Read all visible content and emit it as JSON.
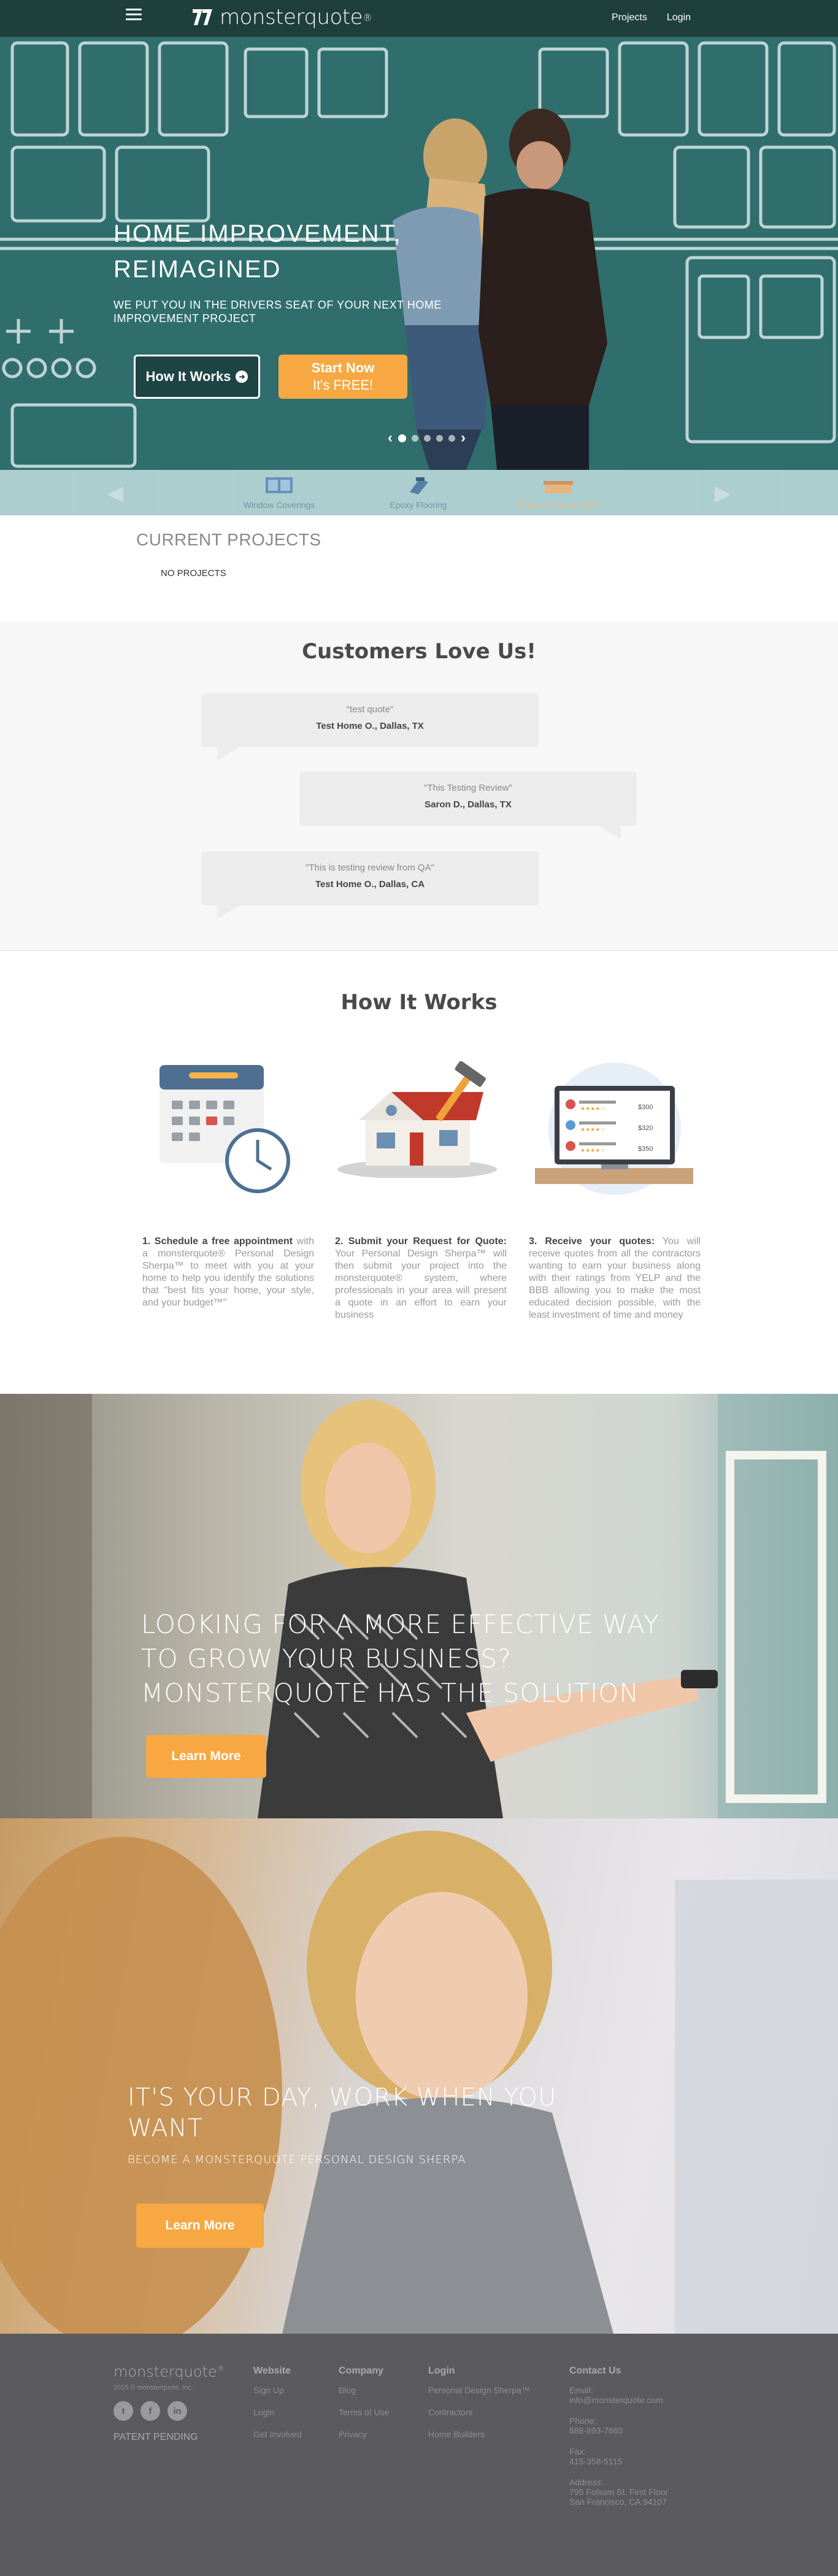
{
  "nav": {
    "brand": "monsterquote",
    "brand_reg": "®",
    "links": [
      "Projects",
      "Login"
    ]
  },
  "hero": {
    "title": "HOME IMPROVEMENT, REIMAGINED",
    "subtitle": "WE PUT YOU IN THE DRIVERS SEAT OF YOUR NEXT HOME IMPROVEMENT PROJECT",
    "how_button": "How It Works",
    "start_line1": "Start Now",
    "start_line2": "It's FREE!",
    "slides": 5,
    "active_slide": 1
  },
  "categories": [
    "Window Coverings",
    "Epoxy Flooring",
    "Granite Counter Tops"
  ],
  "current_projects": {
    "title": "CURRENT PROJECTS",
    "empty": "NO PROJECTS"
  },
  "reviews": {
    "title": "Customers Love Us!",
    "items": [
      {
        "quote": "\"test quote\"",
        "author": "Test Home O., Dallas, TX"
      },
      {
        "quote": "\"This Testing Review\"",
        "author": "Saron D., Dallas, TX"
      },
      {
        "quote": "\"This is testing review from QA\"",
        "author": "Test Home O., Dallas, CA"
      }
    ]
  },
  "how_it_works": {
    "title": "How It Works",
    "steps": [
      {
        "num": "1.",
        "head": "Schedule a free appointment",
        "body": "with a monsterquote® Personal Design Sherpa™ to meet with you at your home to help you identify the solutions that \"best fits your home, your style, and your budget™\""
      },
      {
        "num": "2.",
        "head": "Submit your Request for Quote:",
        "body": "Your Personal Design Sherpa™ will then submit your project into the monsterquote® system, where professionals in your area will present a quote in an effort to earn your business"
      },
      {
        "num": "3.",
        "head": "Receive your quotes:",
        "body": "You will receive quotes from all the contractors wanting to earn your business along with their ratings from YELP and the BBB allowing you to make the most educated decision possible, with the least investment of time and money"
      }
    ],
    "quote_prices": [
      "$300",
      "$320",
      "$350"
    ]
  },
  "promo_business": {
    "title": "LOOKING FOR A MORE EFFECTIVE WAY TO GROW YOUR BUSINESS? MONSTERQUOTE HAS THE SOLUTION",
    "button": "Learn More"
  },
  "promo_sherpa": {
    "title": "IT'S YOUR DAY, WORK WHEN YOU WANT",
    "subtitle": "BECOME A MONSTERQUOTE PERSONAL DESIGN SHERPA",
    "button": "Learn More"
  },
  "footer": {
    "brand": "monsterquote",
    "brand_reg": "®",
    "copyright": "2015 © monsterquote, Inc.",
    "patent": "PATENT PENDING",
    "website": {
      "title": "Website",
      "links": [
        "Sign Up",
        "Login",
        "Get Involved"
      ]
    },
    "company": {
      "title": "Company",
      "links": [
        "Blog",
        "Terms of Use",
        "Privacy"
      ]
    },
    "login": {
      "title": "Login",
      "links": [
        "Personal Design Sherpa™",
        "Contractors",
        "Home Builders"
      ]
    },
    "contact": {
      "title": "Contact Us",
      "email_label": "Email:",
      "email": "info@monsterquote.com",
      "phone_label": "Phone:",
      "phone": "888-893-7660",
      "fax_label": "Fax:",
      "fax": "415-358-5115",
      "address_label": "Address:",
      "address1": "795 Folsom St. First Floor",
      "address2": "San Francisco, CA 94107"
    }
  },
  "colors": {
    "nav_bg": "#1f3f3d",
    "hero_bg": "#2e6f6e",
    "accent_orange": "#f7a843",
    "footer_bg": "#5b5b5d"
  }
}
